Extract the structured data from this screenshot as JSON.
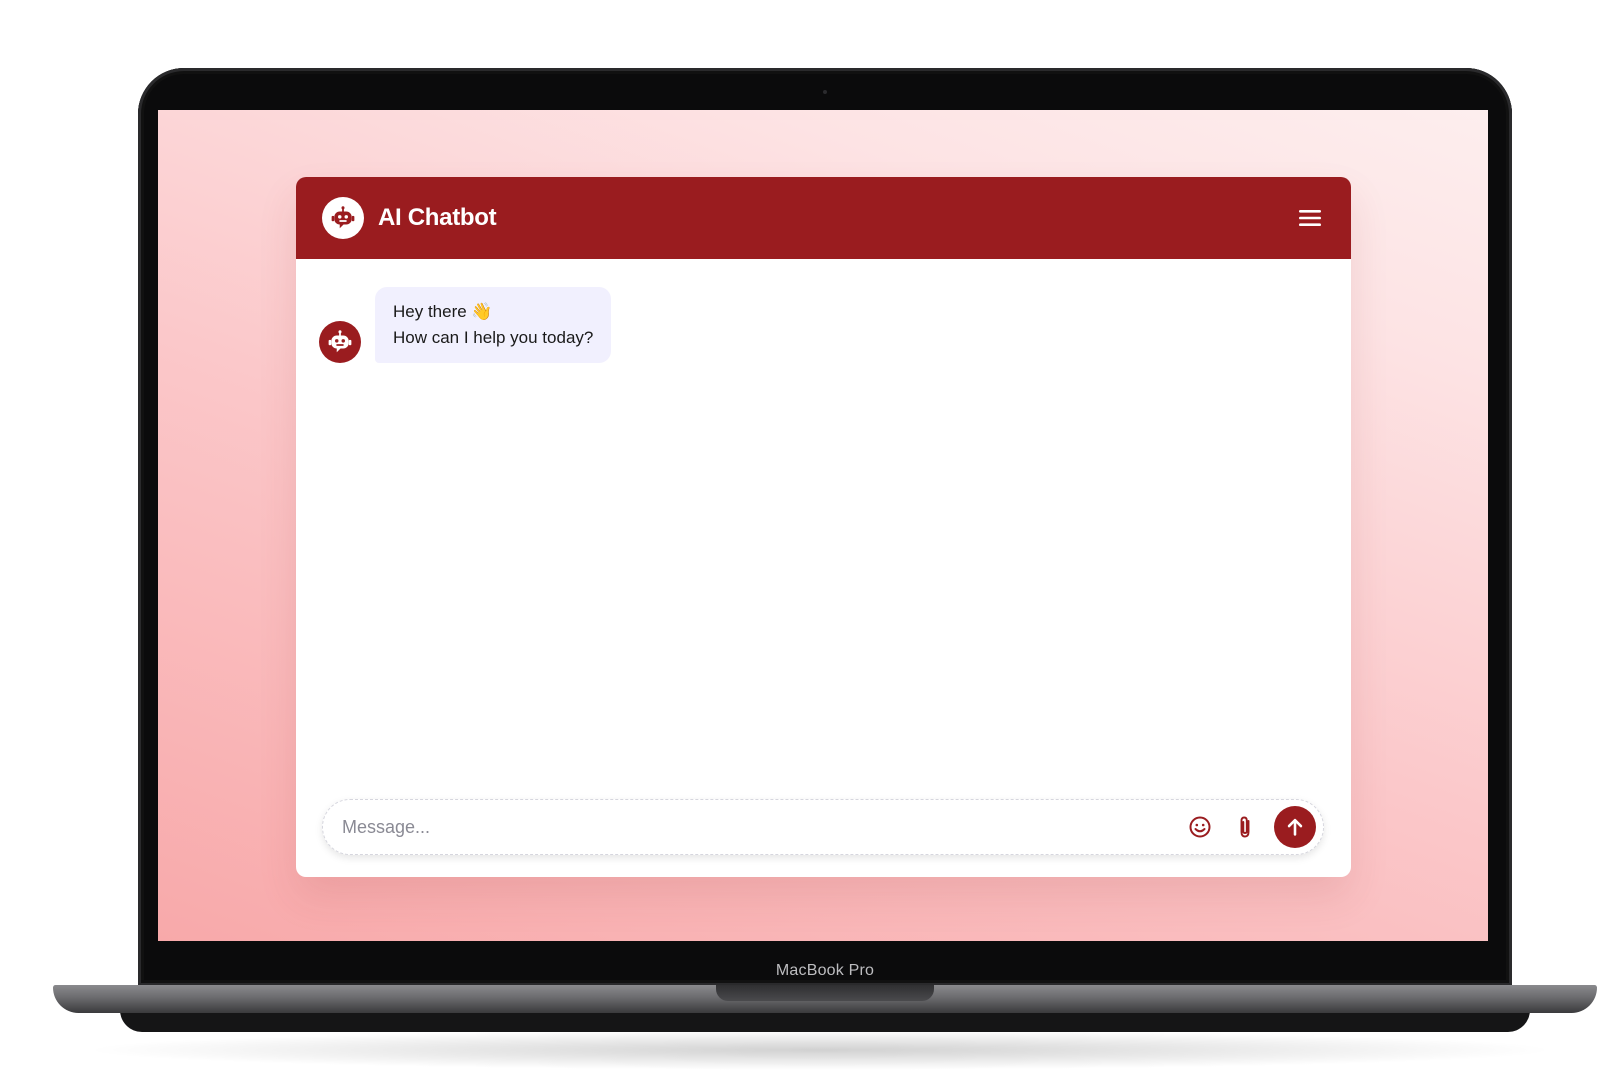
{
  "device": {
    "label": "MacBook Pro"
  },
  "chatbot": {
    "title": "AI Chatbot",
    "accent_color": "#9a1c1f",
    "header_icon": "robot-icon",
    "menu_icon": "hamburger-menu-icon",
    "messages": [
      {
        "sender": "bot",
        "avatar_icon": "robot-icon",
        "lines": [
          "Hey there 👋",
          "How can I help you today?"
        ]
      }
    ],
    "composer": {
      "placeholder": "Message...",
      "value": "",
      "emoji_icon": "emoji-smile-icon",
      "attach_icon": "paperclip-icon",
      "send_icon": "arrow-up-icon"
    }
  }
}
